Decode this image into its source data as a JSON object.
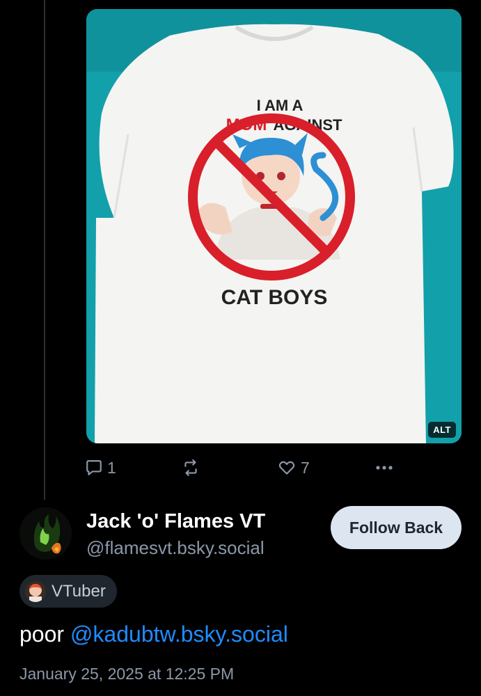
{
  "post_image": {
    "shirt_text_line1": "I AM A",
    "shirt_text_mom": "MOM",
    "shirt_text_against": "AGAINST",
    "shirt_text_bottom": "CAT BOYS",
    "alt_label": "ALT"
  },
  "actions": {
    "reply_count": "1",
    "like_count": "7"
  },
  "author": {
    "display_name": "Jack 'o' Flames VT",
    "handle": "@flamesvt.bsky.social",
    "follow_label": "Follow Back",
    "tag_label": "VTuber"
  },
  "post": {
    "text_prefix": "poor ",
    "mention": "@kadubtw.bsky.social",
    "timestamp": "January 25, 2025 at 12:25 PM"
  },
  "colors": {
    "accent": "#208bfe",
    "muted": "#8b98a8",
    "background": "#000000",
    "follow_bg": "#dde6f0"
  }
}
